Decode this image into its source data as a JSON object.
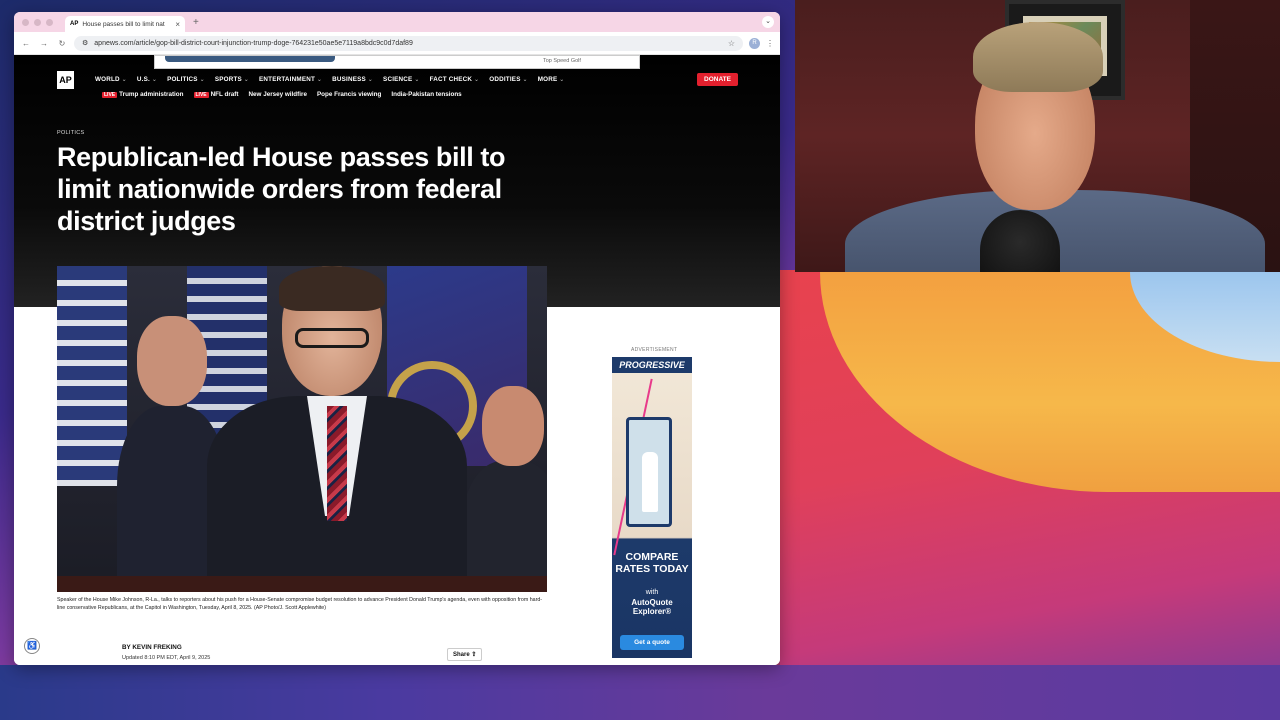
{
  "browser": {
    "tab_title": "House passes bill to limit nat",
    "tab_favicon": "AP",
    "url": "apnews.com/article/gop-bill-district-court-injunction-trump-doge-764231e50ae5e7119a8bdc9c0d7daf89",
    "profile_initial": "R"
  },
  "top_ad": {
    "text": "Top Speed Golf"
  },
  "site": {
    "logo": "AP",
    "nav": [
      "WORLD",
      "U.S.",
      "POLITICS",
      "SPORTS",
      "ENTERTAINMENT",
      "BUSINESS",
      "SCIENCE",
      "FACT CHECK",
      "ODDITIES",
      "MORE"
    ],
    "donate": "DONATE",
    "trending": [
      {
        "live": true,
        "label": "Trump administration"
      },
      {
        "live": true,
        "label": "NFL draft"
      },
      {
        "live": false,
        "label": "New Jersey wildfire"
      },
      {
        "live": false,
        "label": "Pope Francis viewing"
      },
      {
        "live": false,
        "label": "India-Pakistan tensions"
      }
    ],
    "live_badge": "LIVE"
  },
  "article": {
    "kicker": "POLITICS",
    "headline": "Republican-led House passes bill to limit nationwide orders from federal district judges",
    "caption": "Speaker of the House Mike Johnson, R-La., talks to reporters about his push for a House-Senate compromise budget resolution to advance President Donald Trump's agenda, even with opposition from hard-line conservative Republicans, at the Capitol in Washington, Tuesday, April 8, 2025. (AP Photo/J. Scott Applewhite)",
    "byline": "BY KEVIN FREKING",
    "updated": "Updated 8:10 PM EDT, April 9, 2025",
    "share": "Share"
  },
  "sidebar_ad": {
    "label": "ADVERTISEMENT",
    "brand": "PROGRESSIVE",
    "headline": "COMPARE RATES TODAY",
    "with": "with",
    "product": "AutoQuote Explorer®",
    "button": "Get a quote"
  },
  "colors": {
    "accent_red": "#e3202e",
    "tab_bar": "#f6d6e6",
    "ad_blue": "#1d3a6a"
  }
}
